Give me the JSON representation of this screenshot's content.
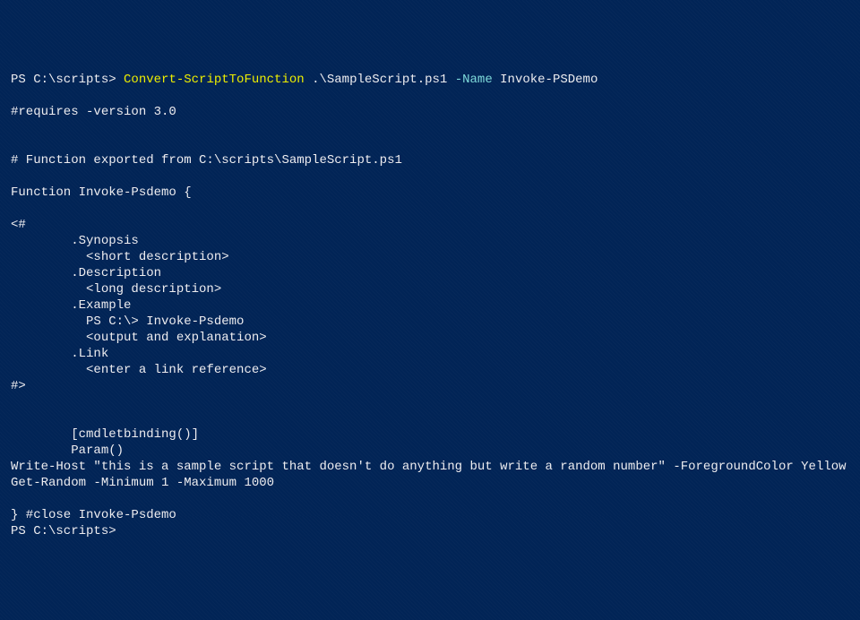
{
  "line1": {
    "prompt": "PS C:\\scripts> ",
    "cmd": "Convert-ScriptToFunction",
    "sp1": " ",
    "arg1": ".\\SampleScript.ps1",
    "sp2": " ",
    "param": "-Name",
    "sp3": " ",
    "arg2": "Invoke-PSDemo"
  },
  "blank": "",
  "requires": "#requires -version 3.0",
  "comment_export": "# Function exported from C:\\scripts\\SampleScript.ps1",
  "func_decl": "Function Invoke-Psdemo {",
  "help_open": "<#",
  "help_synopsis": "        .Synopsis",
  "help_short": "          <short description>",
  "help_description": "        .Description",
  "help_long": "          <long description>",
  "help_example": "        .Example",
  "help_example_cmd": "          PS C:\\> Invoke-Psdemo",
  "help_example_out": "          <output and explanation>",
  "help_link": "        .Link",
  "help_link_ref": "          <enter a link reference>",
  "help_close": "#>",
  "cmdletbinding": "        [cmdletbinding()]",
  "param": "        Param()",
  "writehost": "Write-Host \"this is a sample script that doesn't do anything but write a random number\" -ForegroundColor Yellow",
  "getrandom": "Get-Random -Minimum 1 -Maximum 1000",
  "close_func": "} #close Invoke-Psdemo",
  "prompt_end": "PS C:\\scripts>"
}
